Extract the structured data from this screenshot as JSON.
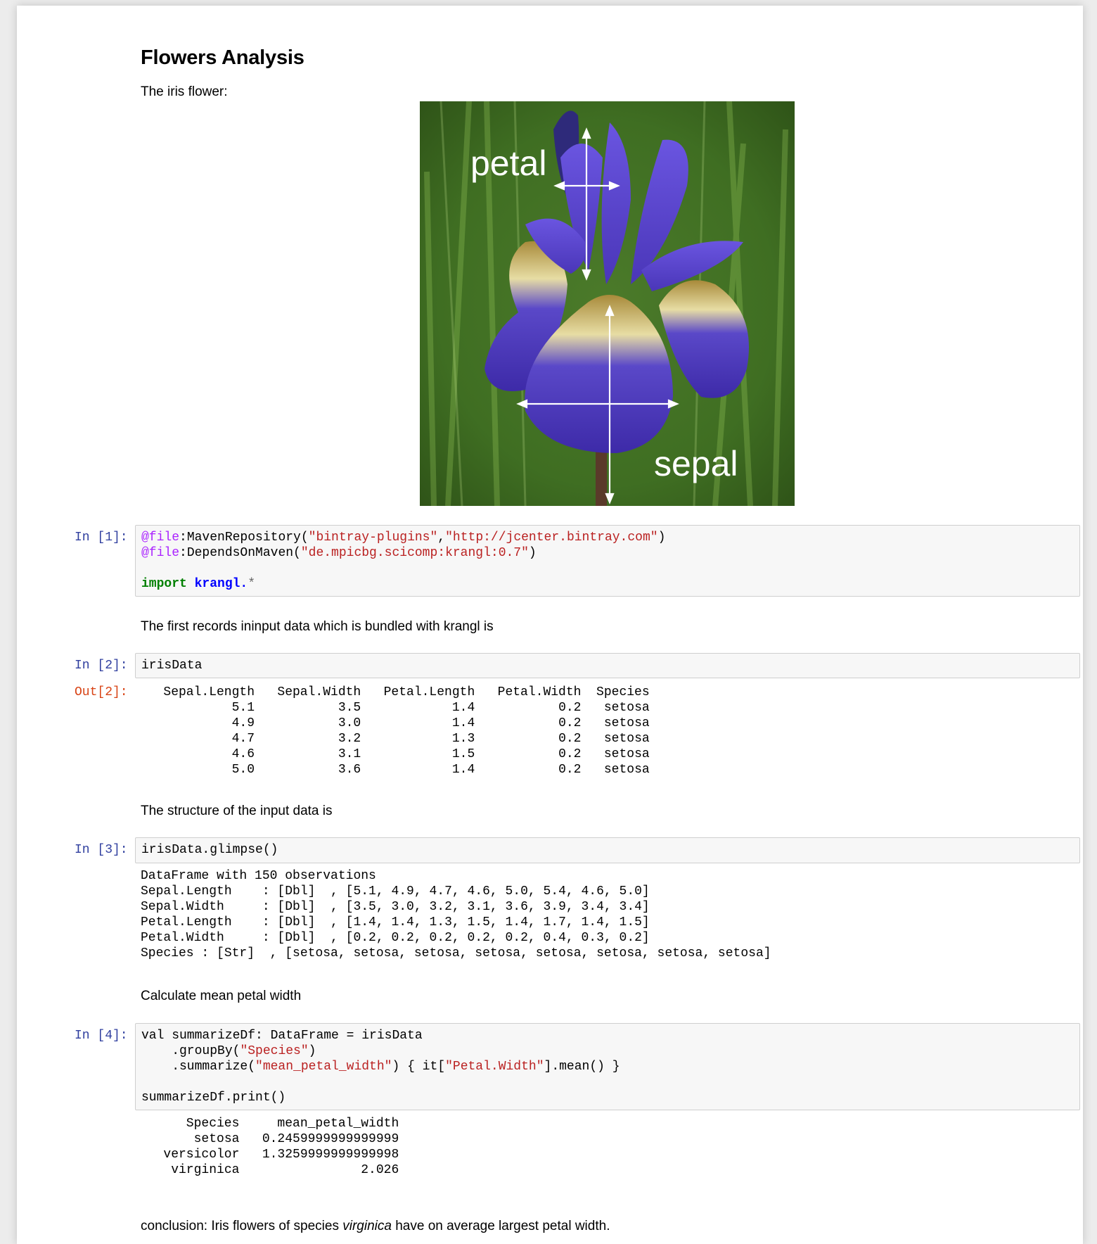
{
  "notebook": {
    "title": "Flowers Analysis",
    "md_iris": "The iris flower:",
    "figure": {
      "petal_label": "petal",
      "sepal_label": "sepal"
    },
    "cells": [
      {
        "prompt": "In [1]:",
        "line1": {
          "dec": "@file",
          "fn": ":MavenRepository(",
          "s1": "\"bintray-plugins\"",
          "comma": ",",
          "s2": "\"http://jcenter.bintray.com\"",
          "end": ")"
        },
        "line2": {
          "dec": "@file",
          "fn": ":DependsOnMaven(",
          "s1": "\"de.mpicbg.scicomp:krangl:0.7\"",
          "end": ")"
        },
        "line3": {
          "kw": "import",
          "mod": "krangl.",
          "star": "*"
        }
      },
      {
        "prompt": "In [2]:",
        "code": "irisData",
        "out_prompt": "Out[2]:"
      },
      {
        "prompt": "In [3]:",
        "code": "irisData.glimpse()"
      },
      {
        "prompt": "In [4]:",
        "l1": "val summarizeDf: DataFrame = irisData",
        "l2a": "    .groupBy(",
        "l2s": "\"Species\"",
        "l2b": ")",
        "l3a": "    .summarize(",
        "l3s": "\"mean_petal_width\"",
        "l3b": ") { it[",
        "l3s2": "\"Petal.Width\"",
        "l3c": "].mean() }",
        "l4": "summarizeDf.print()"
      }
    ],
    "md_first_records": "The first records ininput data which is bundled with krangl is",
    "md_structure": "The structure of the input data is",
    "md_mean": "Calculate mean petal width",
    "conclusion": {
      "pre": "conclusion: Iris flowers of species ",
      "em": "virginica",
      "post": " have on average largest petal width."
    }
  },
  "iris_table": {
    "columns": [
      "Sepal.Length",
      "Sepal.Width",
      "Petal.Length",
      "Petal.Width",
      "Species"
    ],
    "rows": [
      [
        "5.1",
        "3.5",
        "1.4",
        "0.2",
        "setosa"
      ],
      [
        "4.9",
        "3.0",
        "1.4",
        "0.2",
        "setosa"
      ],
      [
        "4.7",
        "3.2",
        "1.3",
        "0.2",
        "setosa"
      ],
      [
        "4.6",
        "3.1",
        "1.5",
        "0.2",
        "setosa"
      ],
      [
        "5.0",
        "3.6",
        "1.4",
        "0.2",
        "setosa"
      ]
    ]
  },
  "glimpse_output": [
    "DataFrame with 150 observations",
    "Sepal.Length    : [Dbl]  , [5.1, 4.9, 4.7, 4.6, 5.0, 5.4, 4.6, 5.0]",
    "Sepal.Width     : [Dbl]  , [3.5, 3.0, 3.2, 3.1, 3.6, 3.9, 3.4, 3.4]",
    "Petal.Length    : [Dbl]  , [1.4, 1.4, 1.3, 1.5, 1.4, 1.7, 1.4, 1.5]",
    "Petal.Width     : [Dbl]  , [0.2, 0.2, 0.2, 0.2, 0.2, 0.4, 0.3, 0.2]",
    "Species : [Str]  , [setosa, setosa, setosa, setosa, setosa, setosa, setosa, setosa]"
  ],
  "summary_table": {
    "columns": [
      "Species",
      "mean_petal_width"
    ],
    "rows": [
      [
        "setosa",
        "0.2459999999999999"
      ],
      [
        "versicolor",
        "1.3259999999999998"
      ],
      [
        "virginica",
        "2.026"
      ]
    ]
  }
}
